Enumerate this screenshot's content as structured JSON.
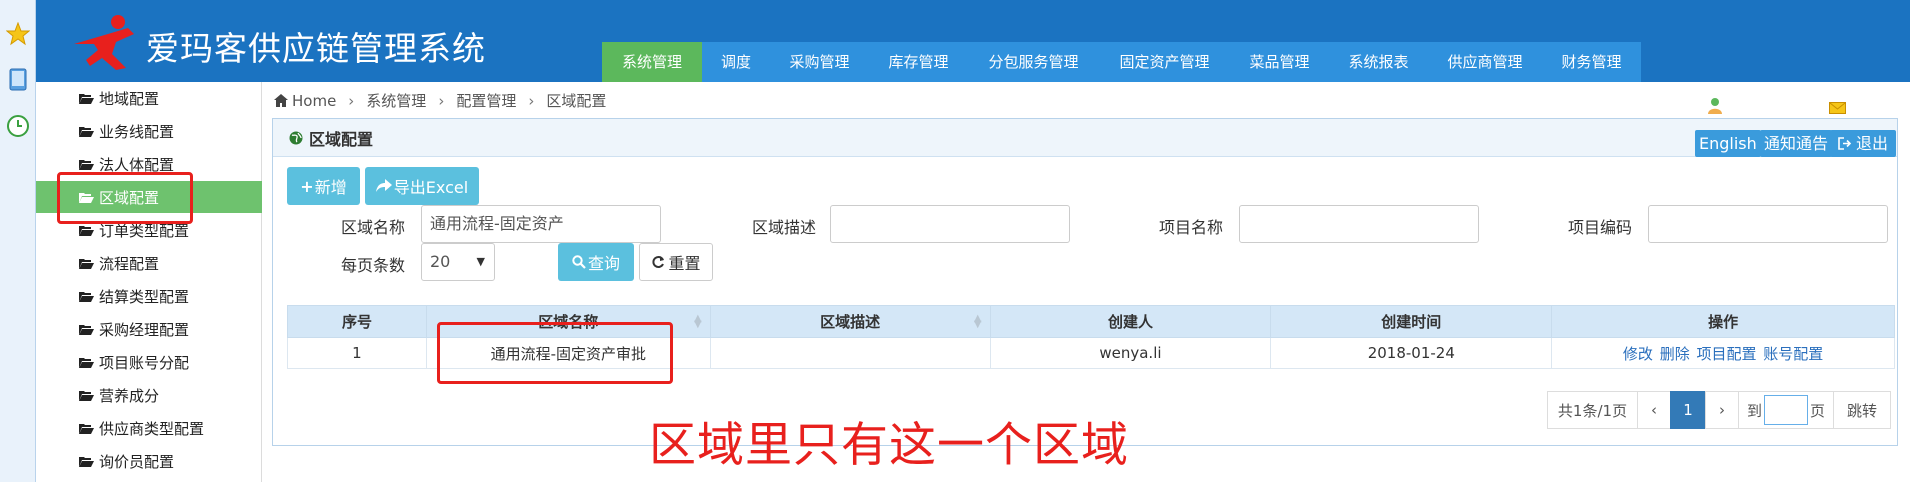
{
  "app": {
    "title": "爱玛客供应链管理系统"
  },
  "rail": {
    "icons": [
      "star-icon",
      "tablet-icon",
      "clock-icon"
    ]
  },
  "topnav": {
    "items": [
      {
        "label": "系统管理",
        "active": true
      },
      {
        "label": "调度"
      },
      {
        "label": "采购管理"
      },
      {
        "label": "库存管理"
      },
      {
        "label": "分包服务管理"
      },
      {
        "label": "固定资产管理"
      },
      {
        "label": "菜品管理"
      },
      {
        "label": "系统报表"
      },
      {
        "label": "供应商管理"
      },
      {
        "label": "财务管理"
      }
    ]
  },
  "sidebar": {
    "items": [
      {
        "label": "地域配置"
      },
      {
        "label": "业务线配置"
      },
      {
        "label": "法人体配置"
      },
      {
        "label": "区域配置",
        "active": true
      },
      {
        "label": "订单类型配置"
      },
      {
        "label": "流程配置"
      },
      {
        "label": "结算类型配置"
      },
      {
        "label": "采购经理配置"
      },
      {
        "label": "项目账号分配"
      },
      {
        "label": "营养成分"
      },
      {
        "label": "供应商类型配置"
      },
      {
        "label": "询价员配置"
      }
    ]
  },
  "breadcrumb": [
    "Home",
    "系统管理",
    "配置管理",
    "区域配置"
  ],
  "header_buttons": {
    "english": "English",
    "notice": "通知通告",
    "logout": "退出"
  },
  "panel": {
    "title": "区域配置"
  },
  "toolbar": {
    "add": "新增",
    "export": "导出Excel"
  },
  "filters": {
    "region_name_label": "区域名称",
    "region_name_value": "通用流程-固定资产",
    "region_desc_label": "区域描述",
    "region_desc_value": "",
    "project_name_label": "项目名称",
    "project_name_value": "",
    "project_code_label": "项目编码",
    "project_code_value": "",
    "page_size_label": "每页条数",
    "page_size_value": "20",
    "query_button": "查询",
    "reset_button": "重置"
  },
  "table": {
    "columns": [
      "序号",
      "区域名称",
      "区域描述",
      "创建人",
      "创建时间",
      "操作"
    ],
    "rows": [
      {
        "index": "1",
        "name": "通用流程-固定资产审批",
        "desc": "",
        "creator": "wenya.li",
        "created": "2018-01-24",
        "actions": [
          "修改",
          "删除",
          "项目配置",
          "账号配置"
        ]
      }
    ]
  },
  "pagination": {
    "summary": "共1条/1页",
    "prev": "‹",
    "current": "1",
    "next": "›",
    "goto_prefix": "到",
    "goto_suffix": "页",
    "jump": "跳转"
  },
  "annotation": {
    "text": "区域里只有这一个区域"
  },
  "colors": {
    "header": "#1b73c1",
    "nav": "#2f91dd",
    "active": "#5cb85c",
    "annotation": "#e8201d"
  }
}
